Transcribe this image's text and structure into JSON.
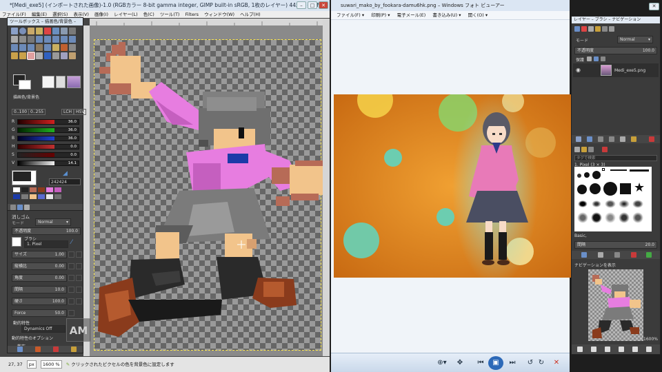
{
  "gimp": {
    "title": "*[Medi_exe5] (インポートされた画像)-1.0 (RGBカラー 8-bit gamma integer, GIMP built-in sRGB, 1枚のレイヤー) 44x54 – GIMP",
    "menu": [
      "ファイル(F)",
      "編集(E)",
      "選択(S)",
      "表示(V)",
      "画像(I)",
      "レイヤー(L)",
      "色(C)",
      "ツール(T)",
      "Filters",
      "ウィンドウ(W)",
      "ヘルプ(H)"
    ],
    "status": {
      "coords": "27, 37",
      "unit": "px",
      "zoom": "1600 %",
      "message": "クリックされたピクセルの色を背景色に設定します"
    }
  },
  "toolbox": {
    "title": "ツールボックス – 描画色/背景色 –",
    "color_section_label": "描画色/背景色",
    "range_a": "0..100",
    "range_b": "0..255",
    "model_lch": "LCH",
    "model_hsv": "HSV",
    "channels": [
      {
        "name": "R",
        "value": "36.0",
        "color": "#d02020"
      },
      {
        "name": "G",
        "value": "36.0",
        "color": "#20b020"
      },
      {
        "name": "B",
        "value": "36.0",
        "color": "#2040d0"
      },
      {
        "name": "H",
        "value": "0.0",
        "color": "#c03030"
      },
      {
        "name": "S",
        "value": "0.0",
        "color": "#808080"
      },
      {
        "name": "V",
        "value": "14.1",
        "color": "#e0e0e0"
      }
    ],
    "hex_value": "242424",
    "tool_name": "消しゴム",
    "mode_label": "モード",
    "mode_value": "Normal",
    "opacity_label": "不透明度",
    "opacity_value": "100.0",
    "brush_label": "ブラシ",
    "brush_value": "1. Pixel",
    "options": [
      {
        "label": "サイズ",
        "value": "1.00"
      },
      {
        "label": "縦横比",
        "value": "0.00"
      },
      {
        "label": "角度",
        "value": "0.00"
      },
      {
        "label": "間隔",
        "value": "10.0"
      },
      {
        "label": "硬さ",
        "value": "100.0"
      },
      {
        "label": "Force",
        "value": "50.0"
      }
    ],
    "dynamics_label": "動的特性",
    "dynamics_value": "Dynamics Off",
    "dynamics_options": "動的特性のオプション",
    "jitter_label": "散布"
  },
  "watermark": "AM",
  "viewer": {
    "title": "suwari_mako_by_fookara-damu6hk.png – Windows フォト ビューアー",
    "menu": [
      "ファイル(F) ▾",
      "印刷(P) ▾",
      "電子メール(E)",
      "書き込み(U) ▾",
      "開く(O) ▾"
    ]
  },
  "dock": {
    "title": "レイヤー – ブラシ – ナビゲーション",
    "mode_label": "モード",
    "mode_value": "Normal",
    "opacity_label": "不透明度",
    "opacity_value": "100.0",
    "lock_label": "保護",
    "layer_name": "Medi_exe5.png",
    "brush_filter": "タグで検索",
    "brush_selected": "1. Pixel (3 × 3)",
    "brush_preset": "Basic,",
    "spacing_label": "間隔",
    "spacing_value": "20.0",
    "navigation_label": "ナビゲーションを表示",
    "nav_zoom": "1600%"
  }
}
